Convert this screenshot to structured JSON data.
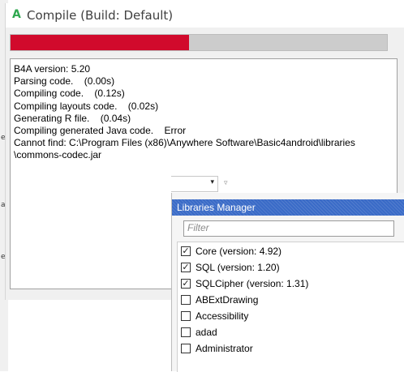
{
  "window": {
    "title": "Compile (Build: Default)",
    "icon": "A"
  },
  "progress": {
    "fraction": 0.475,
    "fill_color": "#d10a2c",
    "track_color": "#cccccc"
  },
  "log": {
    "lines": [
      "B4A version: 5.20",
      "Parsing code.    (0.00s)",
      "Compiling code.    (0.12s)",
      "Compiling layouts code.    (0.02s)",
      "Generating R file.    (0.04s)",
      "Compiling generated Java code.    Error",
      "Cannot find: C:\\Program Files (x86)\\Anywhere Software\\Basic4android\\libraries",
      "\\commons-codec.jar"
    ]
  },
  "left_strip": {
    "glyphs": [
      "e",
      "a",
      "e"
    ]
  },
  "toolbar": {
    "combo_arrow": "▾",
    "pin_icon": "▿"
  },
  "libraries_manager": {
    "title": "Libraries Manager",
    "filter_placeholder": "Filter",
    "items": [
      {
        "label": "Core (version: 4.92)",
        "checked": true
      },
      {
        "label": "SQL (version: 1.20)",
        "checked": true
      },
      {
        "label": "SQLCipher (version: 1.31)",
        "checked": true
      },
      {
        "label": "ABExtDrawing",
        "checked": false
      },
      {
        "label": "Accessibility",
        "checked": false
      },
      {
        "label": "adad",
        "checked": false
      },
      {
        "label": "Administrator",
        "checked": false
      }
    ]
  }
}
